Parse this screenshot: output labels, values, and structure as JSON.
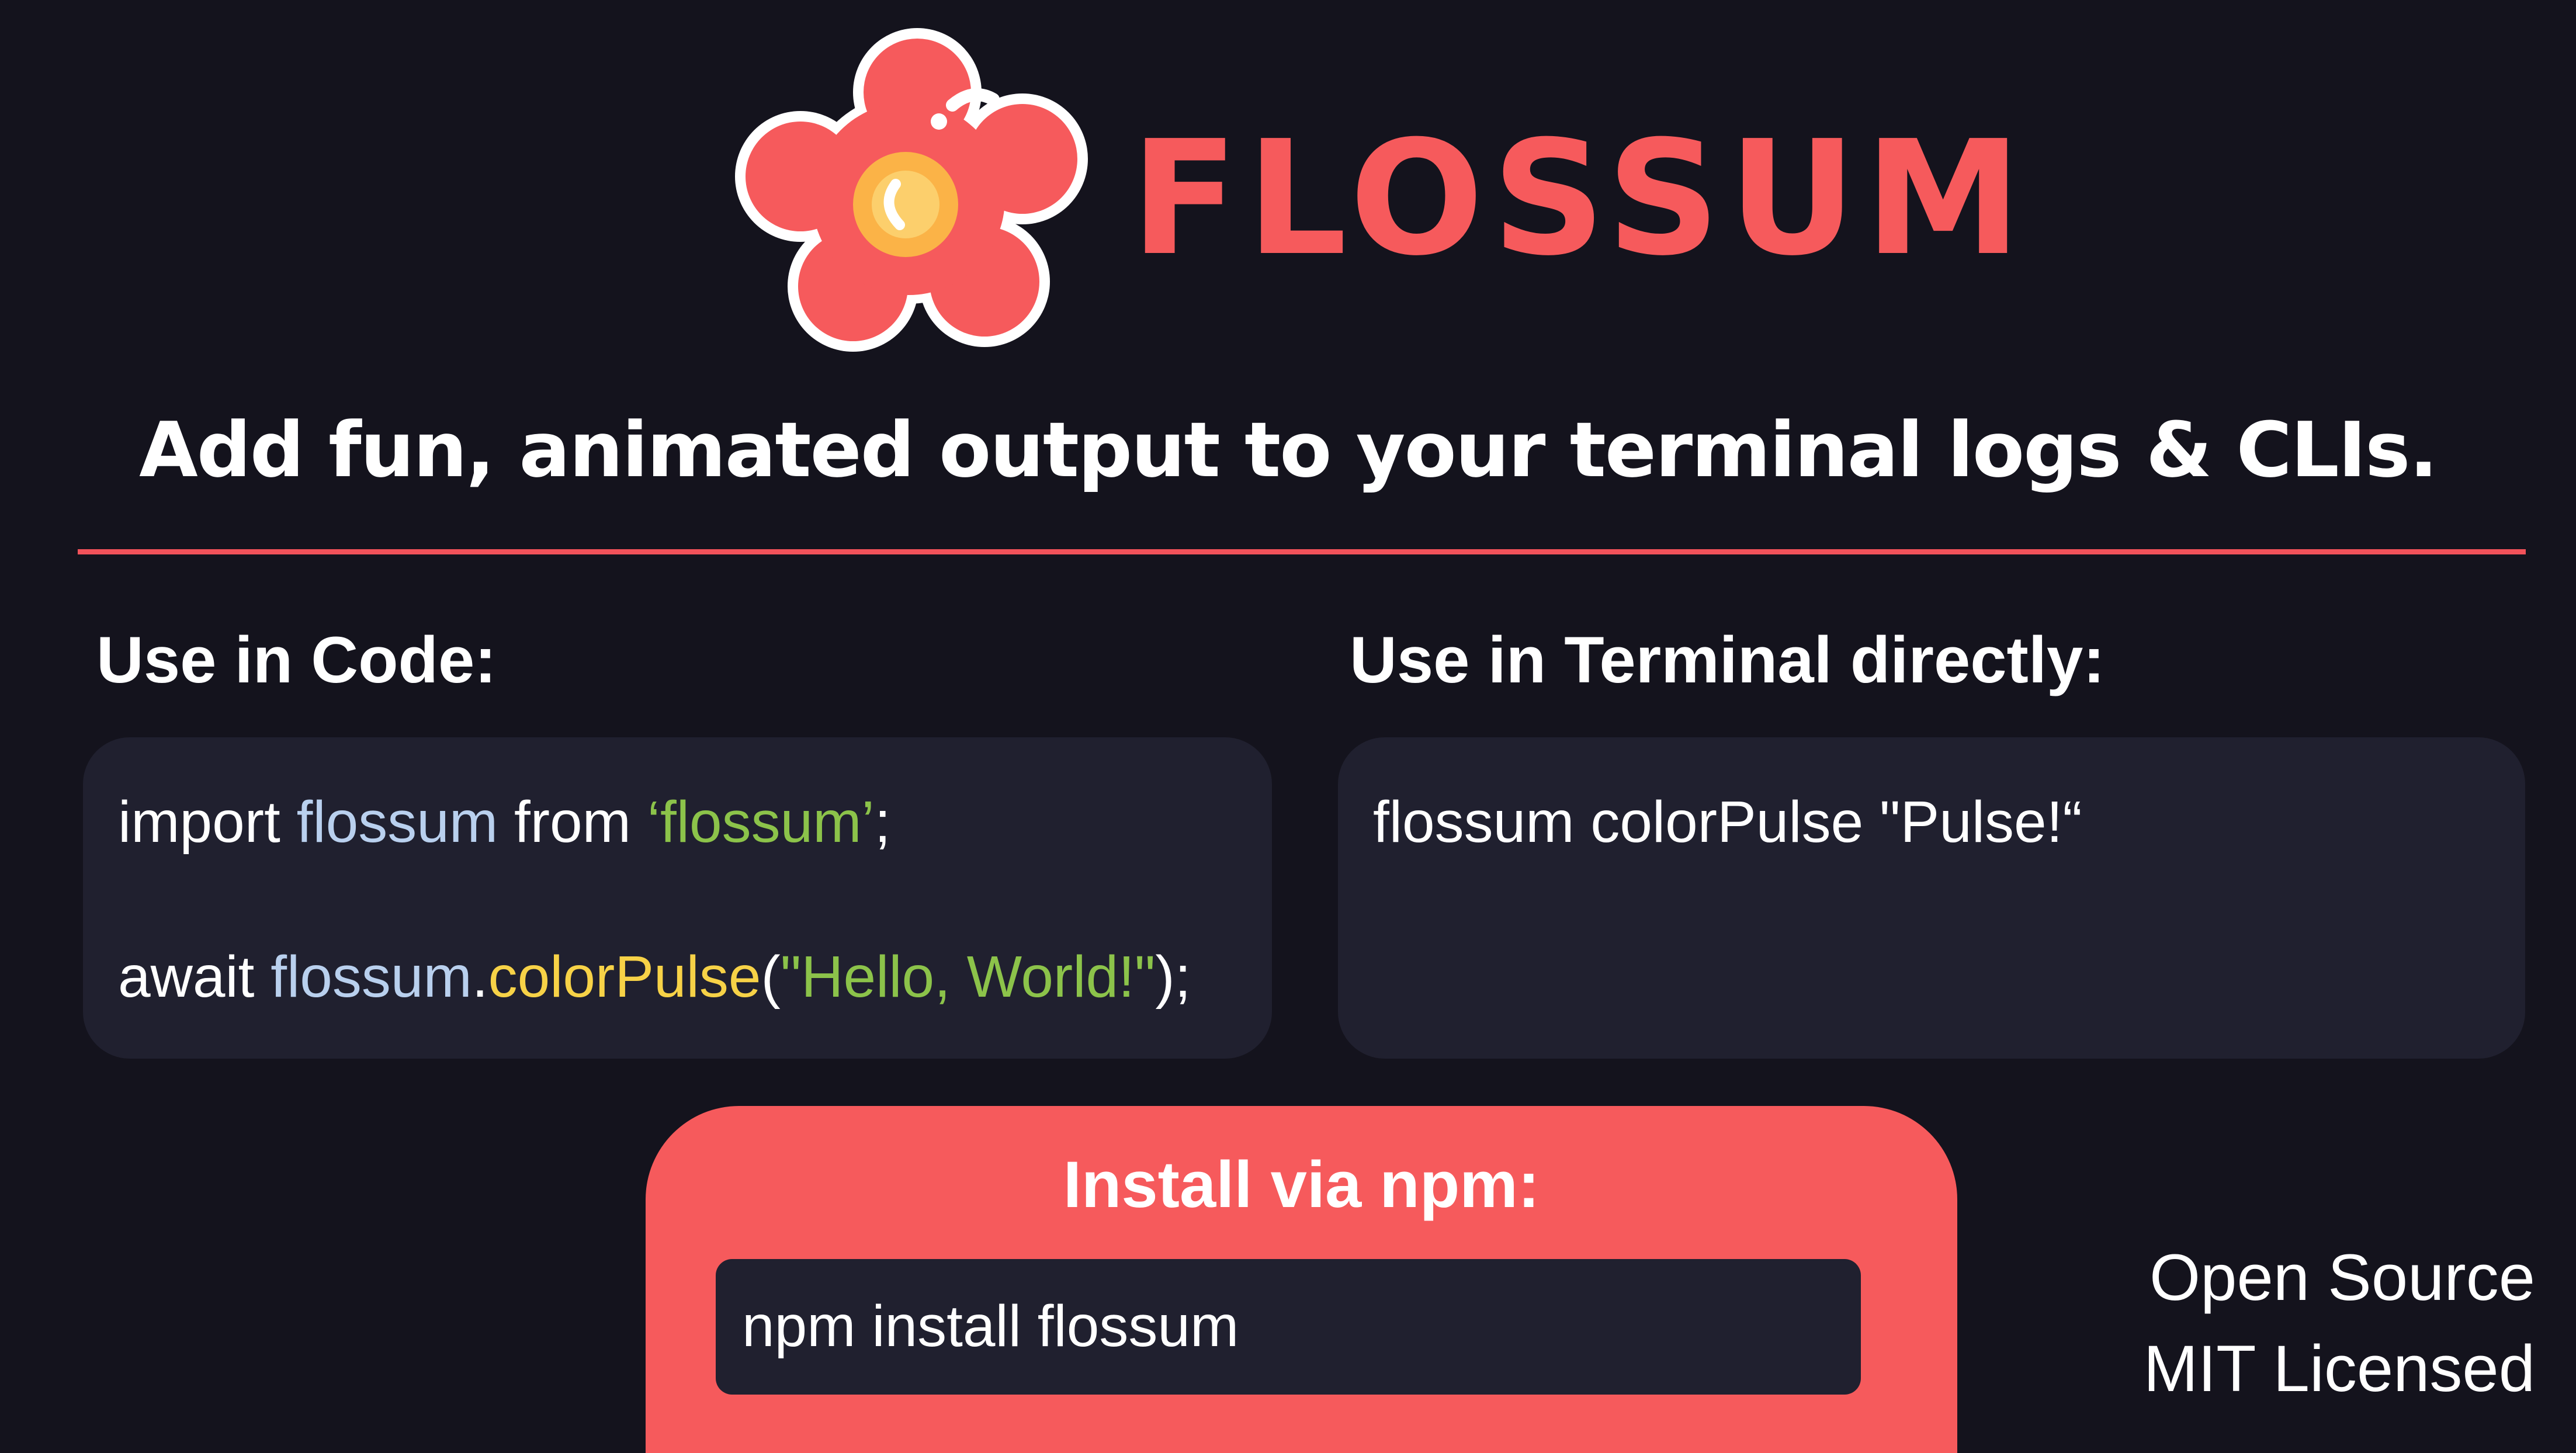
{
  "brand": {
    "name": "FLOSSUM",
    "tagline": "Add fun, animated output to your terminal logs & CLIs.",
    "logo_icon": "flower-icon",
    "colors": {
      "accent": "#f65a5c",
      "background": "#14131d",
      "panel": "#20202f",
      "flower_center": "#fbb347",
      "divider": "#f2525a"
    }
  },
  "code_section": {
    "heading": "Use in Code:",
    "line1": {
      "kw": "import",
      "ident": "flossum",
      "kw2": "from",
      "str": "‘flossum’",
      "end": ";"
    },
    "line2": {
      "kw": "await",
      "obj": "flossum",
      "dot": ".",
      "fn": "colorPulse",
      "open": "(",
      "arg": "\"Hello, World!\"",
      "close": ");"
    },
    "colors": {
      "identifier": "#b9d0ee",
      "string": "#8cc34a",
      "function": "#f7d247"
    }
  },
  "terminal_section": {
    "heading": "Use in Terminal directly:",
    "command": "flossum colorPulse \"Pulse!“"
  },
  "install": {
    "title": "Install via npm:",
    "command": "npm install flossum"
  },
  "license": {
    "line1": "Open Source",
    "line2": "MIT Licensed"
  }
}
